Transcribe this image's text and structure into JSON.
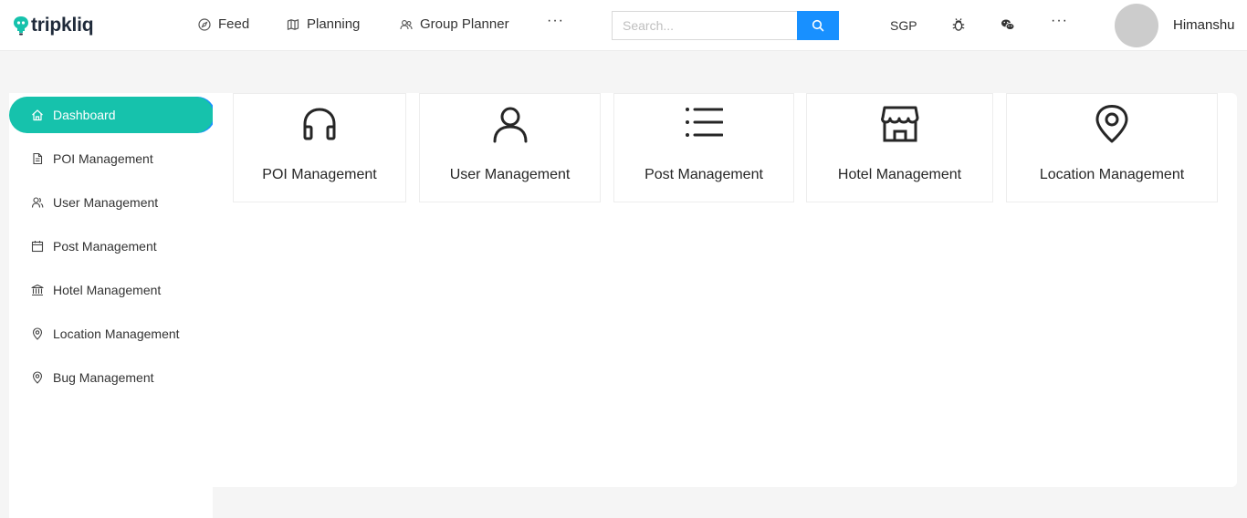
{
  "app": {
    "brand": "tripkliq"
  },
  "nav": {
    "feed": "Feed",
    "planning": "Planning",
    "group_planner": "Group Planner",
    "more": "···"
  },
  "search": {
    "placeholder": "Search..."
  },
  "header_right": {
    "currency": "SGP",
    "more": "···",
    "username": "Himanshu"
  },
  "sidebar": {
    "items": [
      {
        "label": "Dashboard",
        "icon": "home-icon",
        "active": true
      },
      {
        "label": "POI Management",
        "icon": "file-icon"
      },
      {
        "label": "User Management",
        "icon": "users-icon"
      },
      {
        "label": "Post Management",
        "icon": "calendar-icon"
      },
      {
        "label": "Hotel Management",
        "icon": "bank-icon"
      },
      {
        "label": "Location Management",
        "icon": "location-icon"
      },
      {
        "label": "Bug Management",
        "icon": "location-icon"
      }
    ]
  },
  "cards": [
    {
      "label": "POI Management",
      "icon": "headphones-icon"
    },
    {
      "label": "User Management",
      "icon": "user-icon"
    },
    {
      "label": "Post Management",
      "icon": "list-icon"
    },
    {
      "label": "Hotel Management",
      "icon": "store-icon"
    },
    {
      "label": "Location Management",
      "icon": "map-pin-icon"
    }
  ],
  "colors": {
    "accent": "#16c2ac",
    "primary": "#1890ff",
    "background": "#f5f5f5"
  }
}
